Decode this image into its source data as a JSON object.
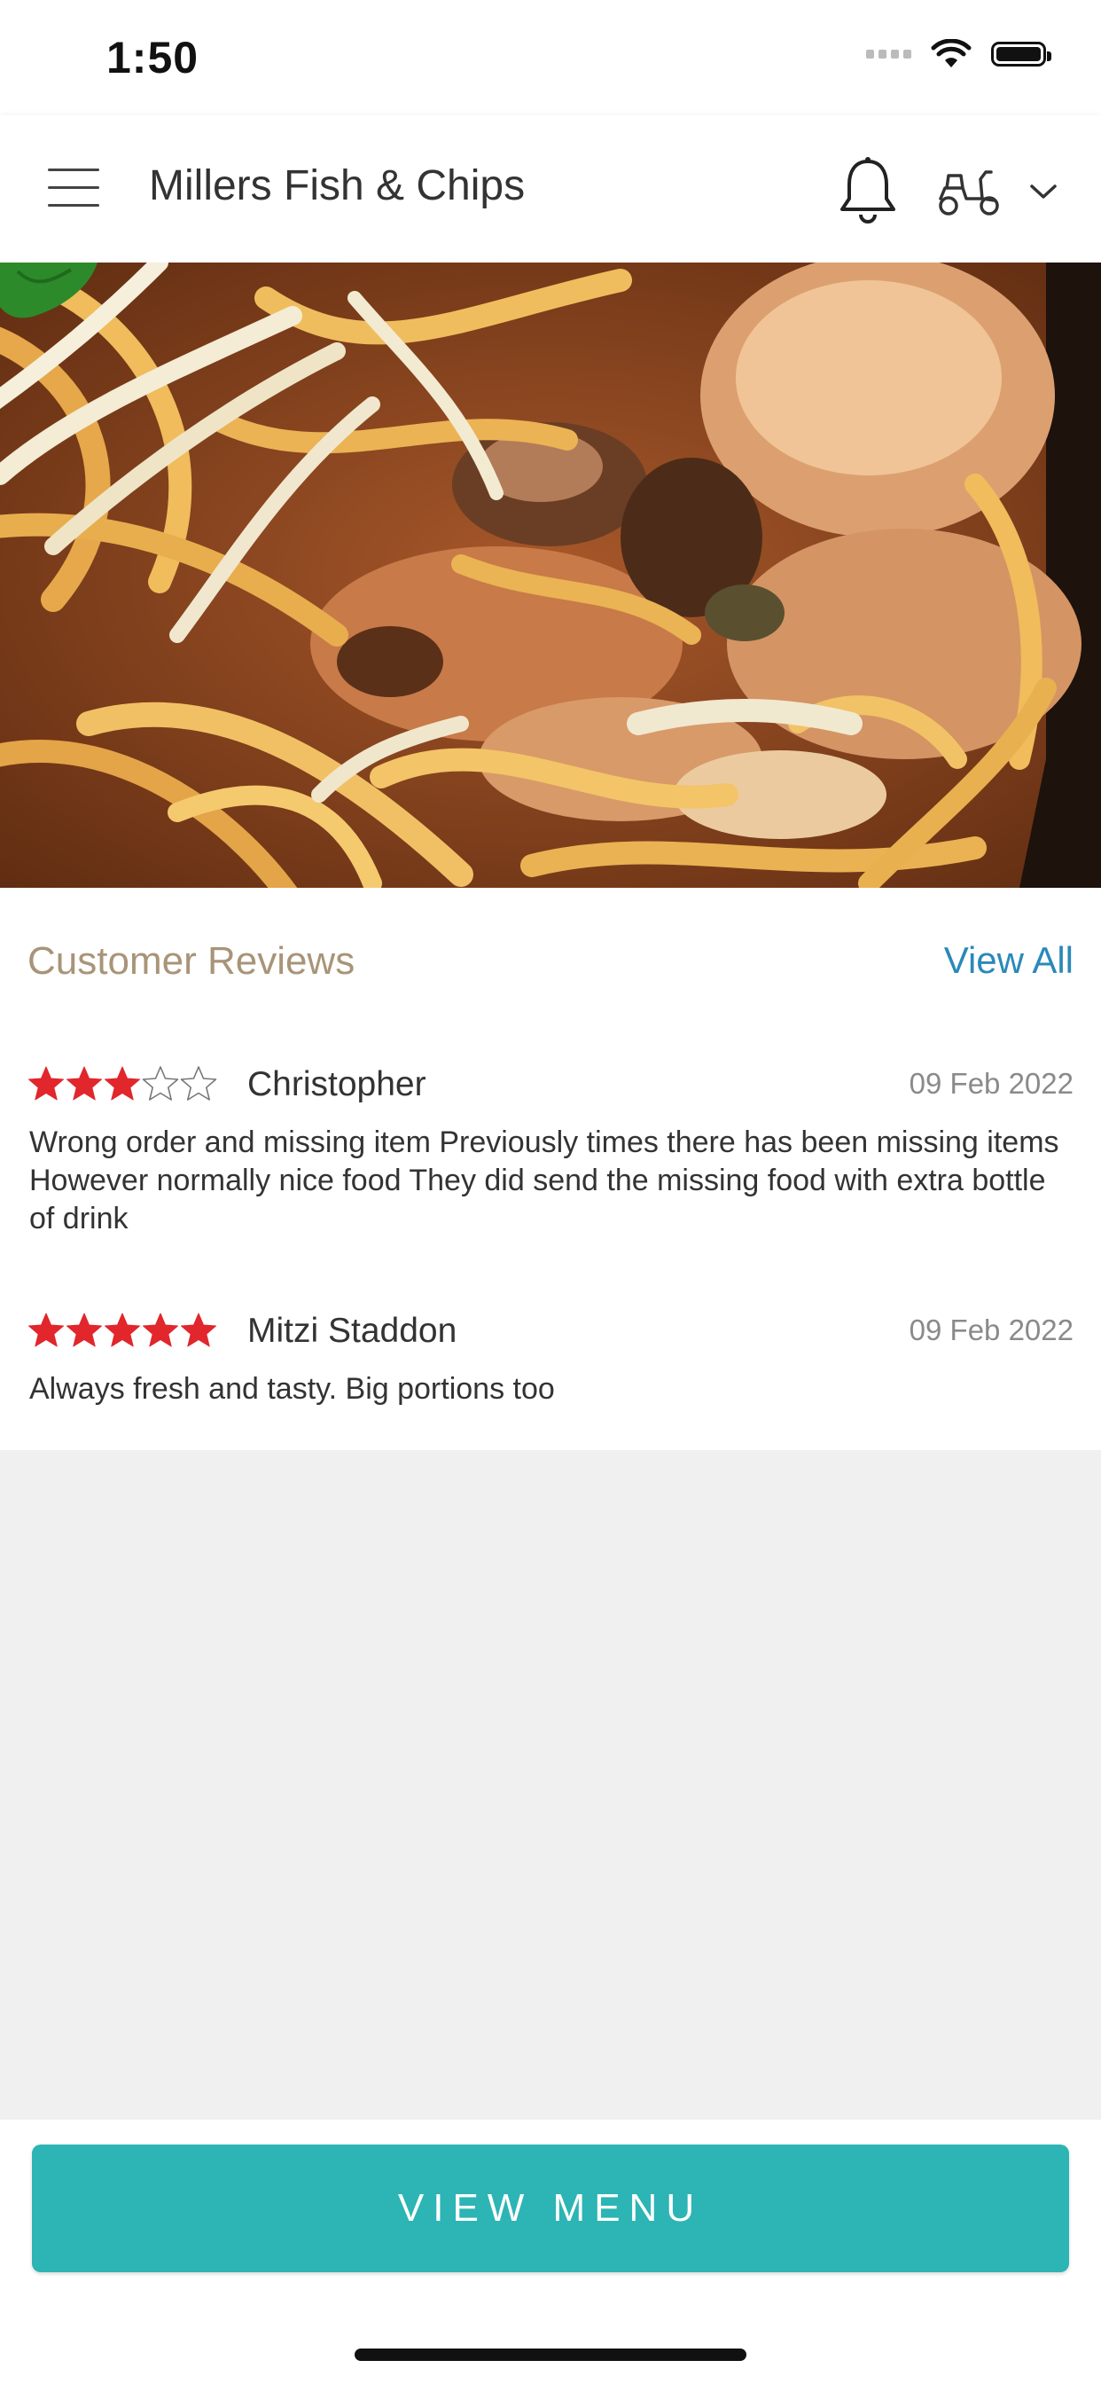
{
  "status_bar": {
    "time": "1:50"
  },
  "header": {
    "title": "Millers Fish & Chips"
  },
  "reviews": {
    "title": "Customer Reviews",
    "view_all_label": "View All",
    "items": [
      {
        "rating": 3,
        "max_rating": 5,
        "name": "Christopher",
        "date": "09 Feb 2022",
        "text": "Wrong order and missing item Previously times there has been missing items However normally nice food They did send the missing food with extra bottle of drink"
      },
      {
        "rating": 5,
        "max_rating": 5,
        "name": "Mitzi Staddon",
        "date": "09 Feb 2022",
        "text": "Always fresh and tasty. Big portions too"
      }
    ]
  },
  "footer": {
    "view_menu_label": "VIEW MENU"
  },
  "colors": {
    "accent_teal": "#2db4b4",
    "link_blue": "#2a89b9",
    "star_red": "#e1262c",
    "reviews_title": "#a89478"
  },
  "icons": [
    "menu-icon",
    "bell-icon",
    "scooter-icon",
    "chevron-down-icon",
    "wifi-icon",
    "battery-icon",
    "star-icon"
  ]
}
